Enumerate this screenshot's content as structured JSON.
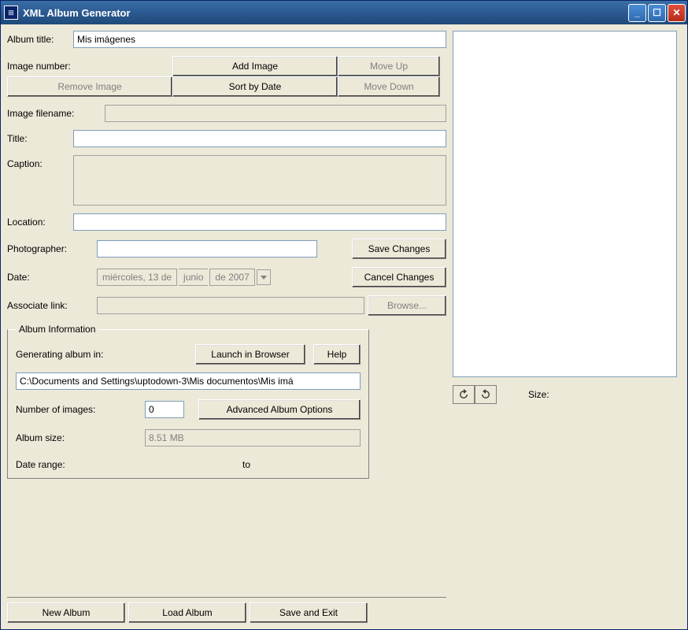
{
  "window": {
    "title": "XML Album Generator"
  },
  "labels": {
    "album_title": "Album title:",
    "image_number": "Image number:",
    "image_filename": "Image filename:",
    "title": "Title:",
    "caption": "Caption:",
    "location": "Location:",
    "photographer": "Photographer:",
    "date": "Date:",
    "associate_link": "Associate link:",
    "size": "Size:"
  },
  "fields": {
    "album_title_value": "Mis imágenes",
    "image_number_value": "",
    "image_filename_value": "",
    "title_value": "",
    "caption_value": "",
    "location_value": "",
    "photographer_value": "",
    "associate_link_value": ""
  },
  "date_parts": {
    "weekday_day": "miércoles, 13 de",
    "month": "junio",
    "of_year": "de 2007"
  },
  "buttons": {
    "add_image": "Add Image",
    "move_up": "Move Up",
    "remove_image": "Remove Image",
    "sort_by_date": "Sort by Date",
    "move_down": "Move Down",
    "save_changes": "Save Changes",
    "cancel_changes": "Cancel Changes",
    "browse": "Browse...",
    "launch_in_browser": "Launch in Browser",
    "help": "Help",
    "advanced_album_options": "Advanced Album Options",
    "new_album": "New Album",
    "load_album": "Load Album",
    "save_and_exit": "Save and Exit"
  },
  "album_info": {
    "legend": "Album Information",
    "generating_label": "Generating album in:",
    "path": "C:\\Documents and Settings\\uptodown-3\\Mis documentos\\Mis imá",
    "num_images_label": "Number of images:",
    "num_images_value": "0",
    "album_size_label": "Album size:",
    "album_size_value": "8.51 MB",
    "date_range_label": "Date range:",
    "date_range_to": "to"
  }
}
